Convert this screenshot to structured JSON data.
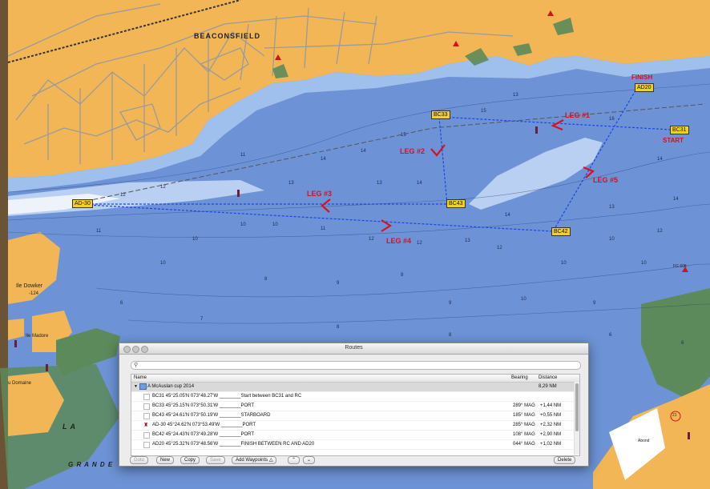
{
  "map": {
    "town_label": "BEACONSFIELD",
    "island_label": "Ile Dowker",
    "island_depth": "-124",
    "island2_label": "Ile Madore",
    "domaine_label": "u Domaine",
    "lake_label_1": "L A",
    "lake_label_2": "G R A N D E",
    "finish_label": "FINISH",
    "start_label": "START",
    "legs": [
      "LEG #1",
      "LEG #2",
      "LEG #3",
      "LEG #4",
      "LEG #5",
      "LEG #3"
    ],
    "waypoints": [
      "AD20",
      "BC31",
      "BC33",
      "BC43",
      "BC42",
      "AD-30"
    ],
    "light_labels": [
      "FG 60ft",
      "Abond",
      "21"
    ],
    "water_color": "#6d93d6",
    "land_color": "#f2b657",
    "route_color": "#1844e8",
    "mark_color": "#d9101e"
  },
  "window": {
    "title": "Routes",
    "search_placeholder": "",
    "columns": {
      "name": "Name",
      "bearing": "Bearing",
      "distance": "Distance"
    },
    "group": {
      "name": "A McAuslan cup 2014",
      "distance": "8,29 NM"
    },
    "rows": [
      {
        "name": "BC31 45°25.05'N 073°48.27'W ________Start between BC31 and RC",
        "bearing": "",
        "distance": ""
      },
      {
        "name": "BC33 45°25.15'N 073°50.31'W ________PORT",
        "bearing": "289° MAG",
        "distance": "+1,44 NM"
      },
      {
        "name": "BC43 45°24.61'N 073°50.19'W ________STARBOARD",
        "bearing": "185° MAG",
        "distance": "+0,55 NM"
      },
      {
        "name": "AD-30 45°24.62'N 073°53.49'W ________PORT",
        "bearing": "285° MAG",
        "distance": "+2,32 NM"
      },
      {
        "name": "BC42 45°24.43'N 073°49.28'W ________PORT",
        "bearing": "108° MAG",
        "distance": "+2,90 NM"
      },
      {
        "name": "AD20 45°25.32'N 073°48.56'W ________FINISH BETWEEN RC AND AD20",
        "bearing": "044° MAG",
        "distance": "+1,02 NM"
      }
    ],
    "buttons": {
      "goto": "Goto",
      "new": "New",
      "copy": "Copy",
      "save": "Save",
      "add_waypoints": "Add Waypoints",
      "delete": "Delete"
    }
  }
}
